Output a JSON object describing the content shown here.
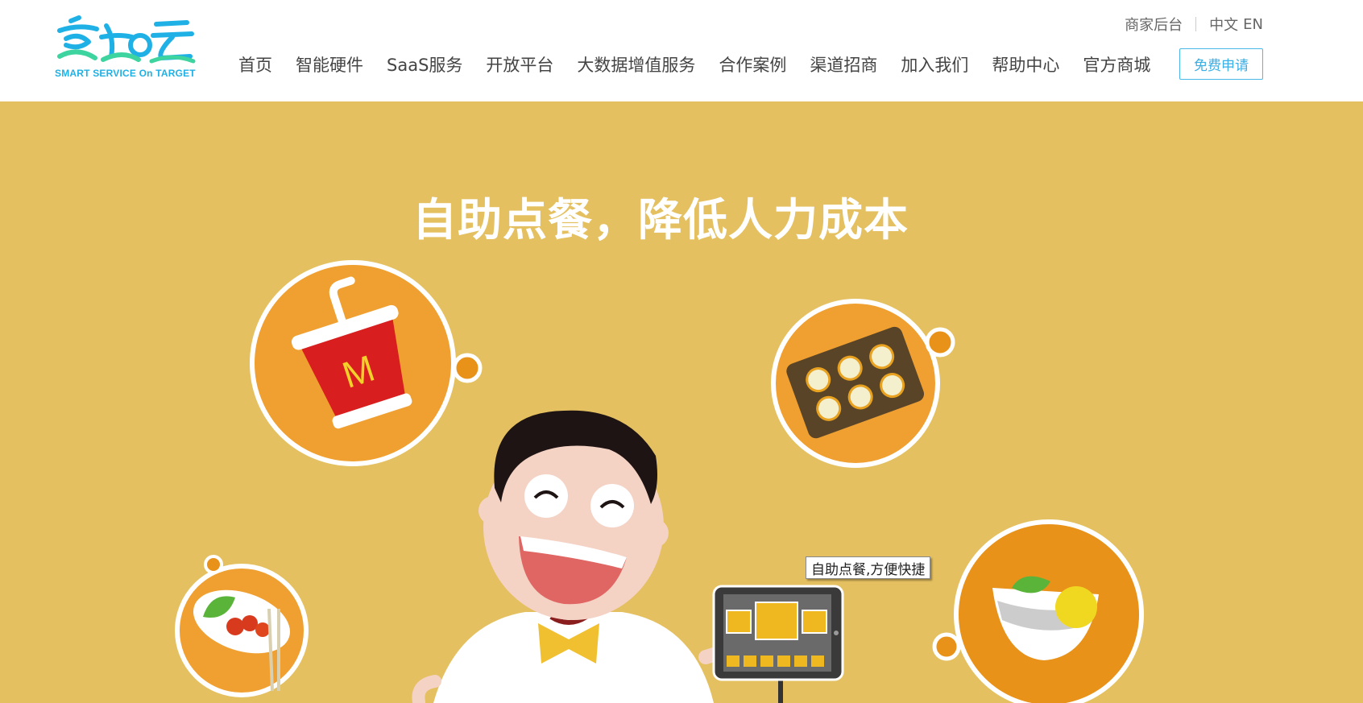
{
  "logo": {
    "tagline": "SMART SERVICE On TARGET",
    "name": "客如云"
  },
  "topbar": {
    "merchant_backend": "商家后台",
    "lang_cn": "中文",
    "lang_en": "EN"
  },
  "nav": {
    "items": [
      {
        "label": "首页"
      },
      {
        "label": "智能硬件"
      },
      {
        "label": "SaaS服务"
      },
      {
        "label": "开放平台"
      },
      {
        "label": "大数据增值服务"
      },
      {
        "label": "合作案例"
      },
      {
        "label": "渠道招商"
      },
      {
        "label": "加入我们"
      },
      {
        "label": "帮助中心"
      },
      {
        "label": "官方商城"
      }
    ],
    "apply_label": "免费申请"
  },
  "hero": {
    "title": "自助点餐，降低人力成本",
    "tooltip": "自助点餐,方便快捷",
    "background_color": "#e4c060",
    "accent_orange": "#f0a030",
    "cup_letter": "M"
  },
  "colors": {
    "brand_blue": "#1fb1e6",
    "brand_green": "#3ed4a0"
  }
}
